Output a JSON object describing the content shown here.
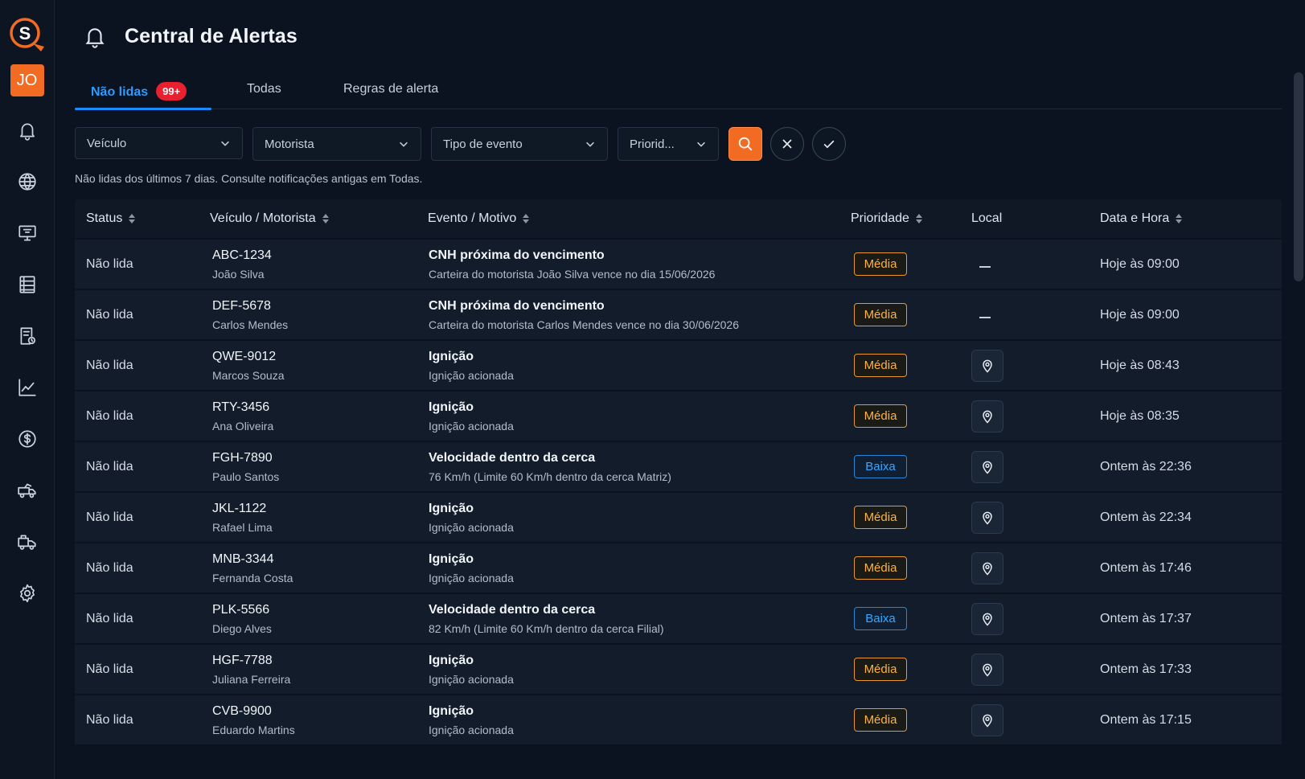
{
  "app": {
    "logo_letter": "S",
    "user_initials": "JO"
  },
  "sidebar": {
    "items": [
      {
        "icon": "bell-icon"
      },
      {
        "icon": "globe-icon"
      },
      {
        "icon": "monitor-icon"
      },
      {
        "icon": "list-icon"
      },
      {
        "icon": "document-icon"
      },
      {
        "icon": "chart-icon"
      },
      {
        "icon": "dollar-icon"
      },
      {
        "icon": "truck-icon"
      },
      {
        "icon": "fleet-icon"
      },
      {
        "icon": "gear-icon"
      }
    ]
  },
  "header": {
    "title": "Central de Alertas"
  },
  "tabs": [
    {
      "label": "Não lidas",
      "badge": "99+"
    },
    {
      "label": "Todas"
    },
    {
      "label": "Regras de alerta"
    }
  ],
  "filters": {
    "vehicle": "Veículo",
    "driver": "Motorista",
    "event_type": "Tipo de evento",
    "priority": "Priorid..."
  },
  "hint": "Não lidas dos últimos 7 dias. Consulte notificações antigas em Todas.",
  "table": {
    "headers": {
      "status": "Status",
      "vehicle_driver": "Veículo / Motorista",
      "event": "Evento / Motivo",
      "priority": "Prioridade",
      "location": "Local",
      "datetime": "Data e Hora"
    },
    "rows": [
      {
        "status": "Não lida",
        "plate": "ABC-1234",
        "driver": "João Silva",
        "event": "CNH próxima do vencimento",
        "detail": "Carteira do motorista João Silva vence no dia 15/06/2026",
        "priority": "Média",
        "has_location": false,
        "datetime": "Hoje às 09:00"
      },
      {
        "status": "Não lida",
        "plate": "DEF-5678",
        "driver": "Carlos Mendes",
        "event": "CNH próxima do vencimento",
        "detail": "Carteira do motorista Carlos Mendes vence no dia 30/06/2026",
        "priority": "Média",
        "has_location": false,
        "datetime": "Hoje às 09:00"
      },
      {
        "status": "Não lida",
        "plate": "QWE-9012",
        "driver": "Marcos Souza",
        "event": "Ignição",
        "detail": "Ignição acionada",
        "priority": "Média",
        "has_location": true,
        "datetime": "Hoje às 08:43"
      },
      {
        "status": "Não lida",
        "plate": "RTY-3456",
        "driver": "Ana Oliveira",
        "event": "Ignição",
        "detail": "Ignição acionada",
        "priority": "Média",
        "has_location": true,
        "datetime": "Hoje às 08:35"
      },
      {
        "status": "Não lida",
        "plate": "FGH-7890",
        "driver": "Paulo Santos",
        "event": "Velocidade dentro da cerca",
        "detail": "76 Km/h (Limite 60 Km/h dentro da cerca Matriz)",
        "priority": "Baixa",
        "has_location": true,
        "datetime": "Ontem às 22:36"
      },
      {
        "status": "Não lida",
        "plate": "JKL-1122",
        "driver": "Rafael Lima",
        "event": "Ignição",
        "detail": "Ignição acionada",
        "priority": "Média",
        "has_location": true,
        "datetime": "Ontem às 22:34"
      },
      {
        "status": "Não lida",
        "plate": "MNB-3344",
        "driver": "Fernanda Costa",
        "event": "Ignição",
        "detail": "Ignição acionada",
        "priority": "Média",
        "has_location": true,
        "datetime": "Ontem às 17:46"
      },
      {
        "status": "Não lida",
        "plate": "PLK-5566",
        "driver": "Diego Alves",
        "event": "Velocidade dentro da cerca",
        "detail": "82 Km/h (Limite 60 Km/h dentro da cerca Filial)",
        "priority": "Baixa",
        "has_location": true,
        "datetime": "Ontem às 17:37"
      },
      {
        "status": "Não lida",
        "plate": "HGF-7788",
        "driver": "Juliana Ferreira",
        "event": "Ignição",
        "detail": "Ignição acionada",
        "priority": "Média",
        "has_location": true,
        "datetime": "Ontem às 17:33"
      },
      {
        "status": "Não lida",
        "plate": "CVB-9900",
        "driver": "Eduardo Martins",
        "event": "Ignição",
        "detail": "Ignição acionada",
        "priority": "Média",
        "has_location": true,
        "datetime": "Ontem às 17:15"
      }
    ]
  },
  "colors": {
    "accent": "#f26b22",
    "tab_active": "#1b8cff",
    "badge": "#e8202f",
    "priority_medium": "#ffb23e",
    "priority_low": "#3aa6ff",
    "background": "#0b1320"
  }
}
